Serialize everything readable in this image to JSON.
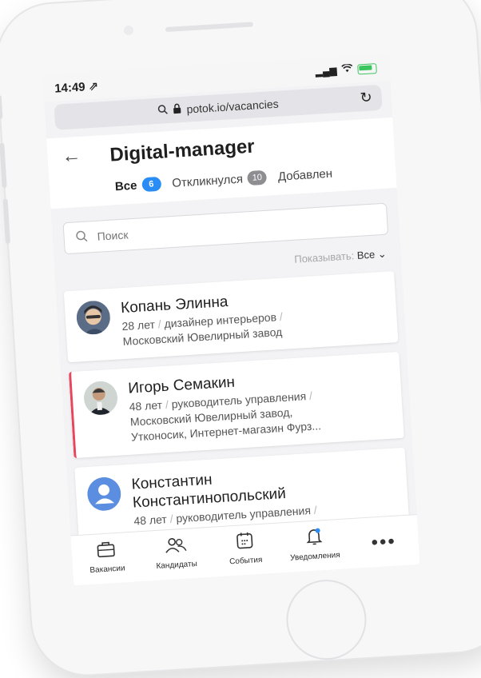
{
  "status": {
    "time": "14:49 ⇗"
  },
  "browser": {
    "url": "potok.io/vacancies"
  },
  "header": {
    "title": "Digital-manager",
    "tabs": [
      {
        "label": "Все",
        "count": "6"
      },
      {
        "label": "Откликнулся",
        "count": "10"
      },
      {
        "label": "Добавлен",
        "count": ""
      }
    ]
  },
  "search": {
    "placeholder": "Поиск"
  },
  "filter": {
    "label": "Показывать:",
    "value": "Все ⌄"
  },
  "candidates": [
    {
      "name": "Копань Элинна",
      "age": "28 лет",
      "role": "дизайнер интерьеров",
      "company": "Московский Ювелирный завод"
    },
    {
      "name": "Игорь Семакин",
      "age": "48 лет",
      "role": "руководитель управления",
      "company": "Московский Ювелирный завод,",
      "company2": "Утконосик, Интернет-магазин Фурз..."
    },
    {
      "name": "Константин",
      "name2": "Константинопольский",
      "age": "48 лет",
      "role": "руководитель управления"
    }
  ],
  "tabbar": [
    {
      "label": "Вакансии"
    },
    {
      "label": "Кандидаты"
    },
    {
      "label": "События"
    },
    {
      "label": "Уведомления"
    },
    {
      "label": "•••"
    }
  ],
  "colors": {
    "accent": "#2a8df5",
    "marker": "#e8455d"
  }
}
